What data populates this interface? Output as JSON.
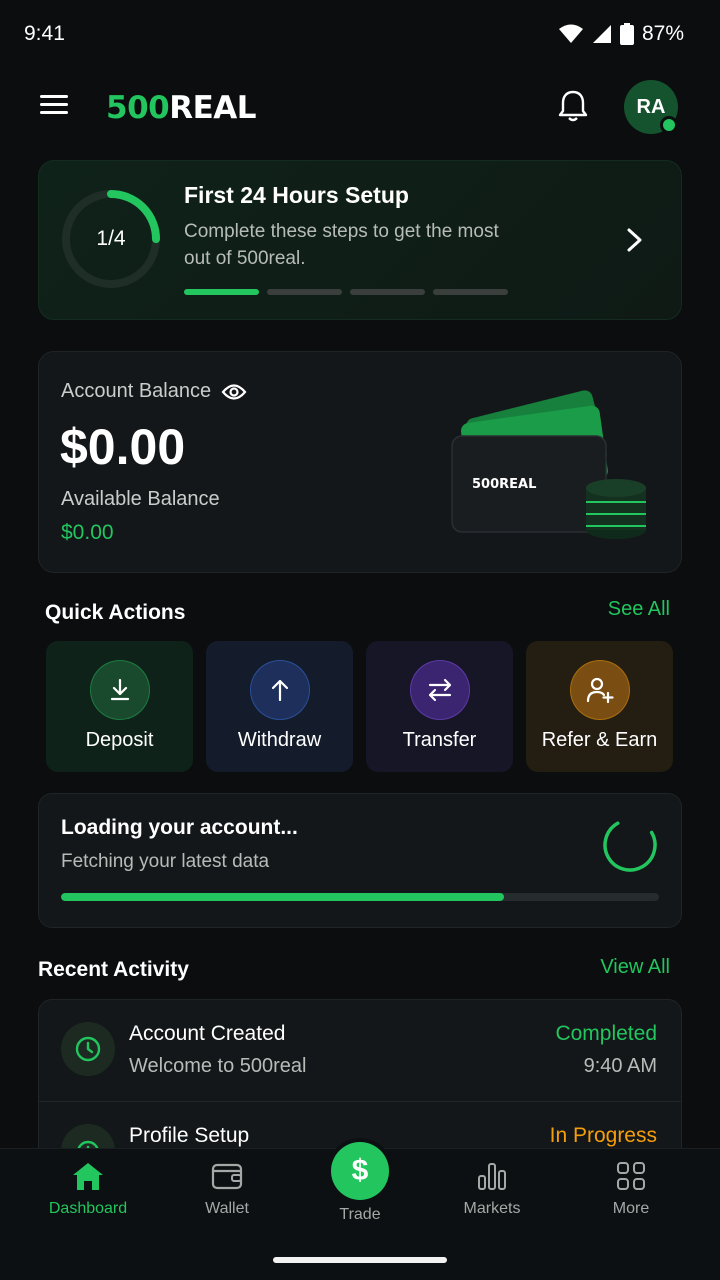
{
  "status_bar": {
    "time": "9:41",
    "battery": "87%"
  },
  "header": {
    "logo_green": "500",
    "logo_white": "REAL",
    "avatar_initials": "RA"
  },
  "setup": {
    "progress": "1/4",
    "progress_fraction": 0.25,
    "title": "First 24 Hours Setup",
    "description": "Complete these steps to get the most out of 500real."
  },
  "balance": {
    "label": "Account Balance",
    "amount": "$0.00",
    "available_label": "Available Balance",
    "available_value": "$0.00",
    "card_brand": "500REAL"
  },
  "quick_actions": {
    "title": "Quick Actions",
    "see_all": "See All",
    "items": [
      {
        "label": "Deposit",
        "icon": "download-arrow-icon",
        "color": "#22c55e"
      },
      {
        "label": "Withdraw",
        "icon": "upload-arrow-icon",
        "color": "#3b82f6"
      },
      {
        "label": "Transfer",
        "icon": "swap-arrows-icon",
        "color": "#8b5cf6"
      },
      {
        "label": "Refer & Earn",
        "icon": "add-user-icon",
        "color": "#f59e0b"
      }
    ]
  },
  "loading": {
    "title": "Loading your account...",
    "subtitle": "Fetching your latest data",
    "progress": 0.74
  },
  "recent_activity": {
    "title": "Recent Activity",
    "view_all": "View All",
    "items": [
      {
        "title": "Account Created",
        "subtitle": "Welcome to 500real",
        "status": "Completed",
        "status_color": "#22c55e",
        "time": "9:40 AM",
        "icon": "clock-icon"
      },
      {
        "title": "Profile Setup",
        "subtitle": "",
        "status": "In Progress",
        "status_color": "#f59e0b",
        "time": "",
        "icon": "timer-icon"
      }
    ]
  },
  "nav": {
    "items": [
      {
        "label": "Dashboard",
        "icon": "home-icon",
        "active": true
      },
      {
        "label": "Wallet",
        "icon": "wallet-icon",
        "active": false
      },
      {
        "label": "Trade",
        "icon": "dollar-icon",
        "active": false,
        "symbol": "$"
      },
      {
        "label": "Markets",
        "icon": "bar-chart-icon",
        "active": false
      },
      {
        "label": "More",
        "icon": "grid-icon",
        "active": false
      }
    ]
  },
  "colors": {
    "accent": "#22c55e",
    "warning": "#f59e0b",
    "background": "#0b0d0e",
    "card": "#141719"
  }
}
